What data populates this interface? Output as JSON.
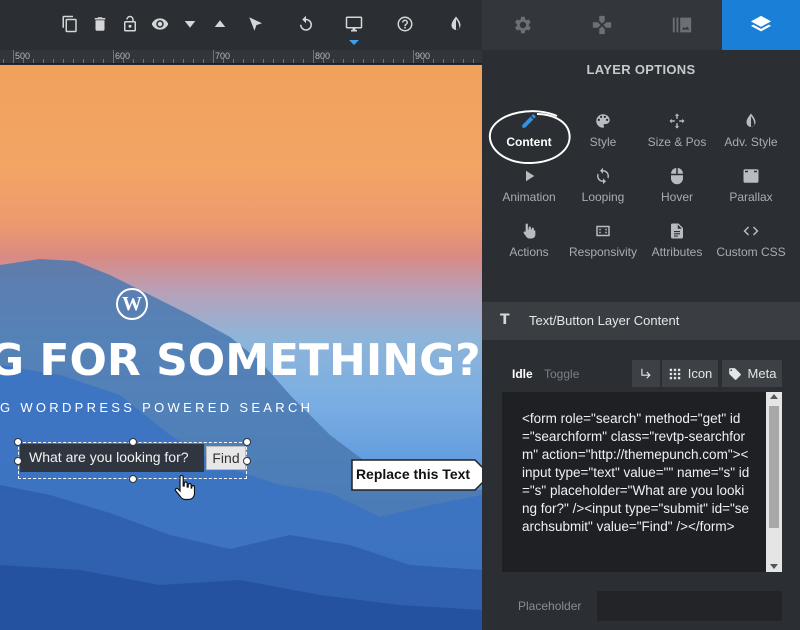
{
  "canvas": {
    "toolbar": {
      "icons": [
        "copy-icon",
        "trash-icon",
        "lock-icon",
        "eye-icon",
        "arrow-down-icon",
        "arrow-up-icon",
        "pointer-icon",
        "undo-icon",
        "desktop-icon",
        "help-icon",
        "contrast-icon"
      ]
    },
    "ruler": {
      "labels": [
        "500",
        "600",
        "700",
        "800",
        "900"
      ]
    },
    "slide": {
      "headline": "G FOR SOMETHING?",
      "subline": "G WORDPRESS POWERED SEARCH",
      "logo_letter": "W",
      "search_placeholder": "What are you looking for?",
      "search_button": "Find"
    }
  },
  "panel": {
    "top_tabs": [
      "gear-icon",
      "gamepad-icon",
      "gallery-icon",
      "layers-icon"
    ],
    "title": "LAYER OPTIONS",
    "options": [
      {
        "label": "Content",
        "icon": "pencil-icon",
        "active": true
      },
      {
        "label": "Style",
        "icon": "palette-icon"
      },
      {
        "label": "Size & Pos",
        "icon": "move-icon"
      },
      {
        "label": "Adv. Style",
        "icon": "contrast-icon"
      },
      {
        "label": "Animation",
        "icon": "play-icon"
      },
      {
        "label": "Looping",
        "icon": "refresh-icon"
      },
      {
        "label": "Hover",
        "icon": "mouse-icon"
      },
      {
        "label": "Parallax",
        "icon": "download-icon"
      },
      {
        "label": "Actions",
        "icon": "hand-pointer-icon"
      },
      {
        "label": "Responsivity",
        "icon": "responsive-icon"
      },
      {
        "label": "Attributes",
        "icon": "file-icon"
      },
      {
        "label": "Custom CSS",
        "icon": "code-icon"
      }
    ],
    "section_title": "Text/Button Layer Content",
    "section_icon_letter": "T",
    "state_tabs": {
      "idle": "Idle",
      "toggle": "Toggle"
    },
    "buttons": {
      "icon": "Icon",
      "meta": "Meta"
    },
    "code_text": "<form role=\"search\" method=\"get\" id=\"searchform\" class=\"revtp-searchform\" action=\"http://themepunch.com\"><input type=\"text\" value=\"\" name=\"s\" id=\"s\" placeholder=\"What are you looking for?\" /><input type=\"submit\" id=\"searchsubmit\" value=\"Find\" /></form>",
    "placeholder_label": "Placeholder",
    "placeholder_value": ""
  },
  "callout": {
    "text": "Replace this Text"
  },
  "colors": {
    "accent": "#1a7fd6",
    "panel_bg": "#2b2e33",
    "code_bg": "#1e2024"
  }
}
